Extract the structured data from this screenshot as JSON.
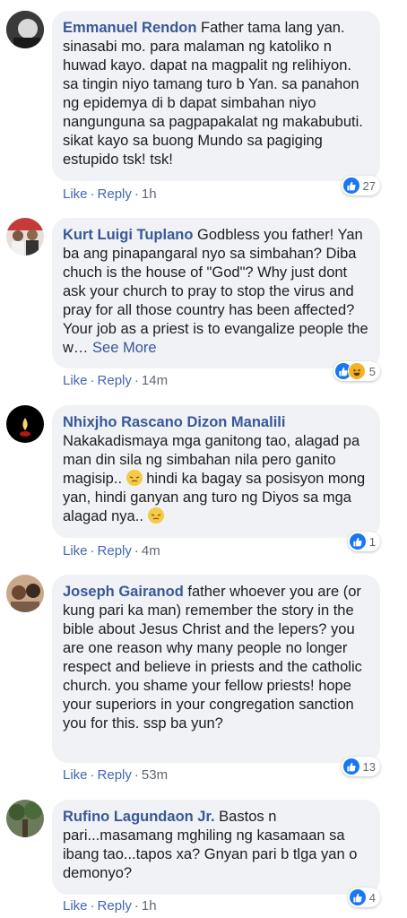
{
  "actions": {
    "like": "Like",
    "reply": "Reply",
    "sep": "·"
  },
  "comments": [
    {
      "author": "Emmanuel Rendon",
      "text": "Father tama lang yan. sinasabi mo. para malaman ng katoliko n huwad kayo. dapat na magpalit ng relihiyon. sa tingin niyo tamang turo b Yan. sa panahon ng epidemya di b dapat simbahan niyo nangunguna sa pagpapakalat ng makabubuti. sikat kayo sa buong Mundo sa pagiging estupido tsk! tsk!",
      "time": "1h",
      "reaction_count": "27",
      "reactions": [
        "like-icon"
      ]
    },
    {
      "author": "Kurt Luigi Tuplano",
      "text": "Godbless you father! Yan ba ang pinapangaral nyo sa simbahan? Diba chuch is the house of \"God\"? Why just dont ask your church to pray to stop the virus and pray for all those country has been affected? Your job as a priest is to evangalize people the w…",
      "see_more": "See More",
      "time": "14m",
      "reaction_count": "5",
      "reactions": [
        "like-icon",
        "haha-icon"
      ]
    },
    {
      "author": "Nhixjho Rascano Dizon Manalili",
      "text_a": "Nakakadismaya mga ganitong tao, alagad pa man din sila ng simbahan nila pero ganito magisip..",
      "text_b": "hindi ka bagay sa posisyon mong yan, hindi ganyan ang turo ng Diyos sa mga alagad nya..",
      "emoji": "pensive-face-emoji",
      "time": "4m",
      "reaction_count": "1",
      "reactions": [
        "like-icon"
      ]
    },
    {
      "author": "Joseph Gairanod",
      "text": "father whoever you are (or kung pari ka man) remember the story in the bible about Jesus Christ and the lepers? you are one reason why many people no longer respect and believe in priests and the catholic church. you shame your fellow priests! hope your superiors in your congregation sanction you for this. ssp ba yun?",
      "time": "53m",
      "reaction_count": "13",
      "reactions": [
        "like-icon"
      ]
    },
    {
      "author": "Rufino Lagundaon Jr.",
      "text": "Bastos n pari...masamang mghiling ng kasamaan sa ibang tao...tapos xa? Gnyan pari b tlga yan o demonyo?",
      "time": "1h",
      "reaction_count": "4",
      "reactions": [
        "like-icon"
      ]
    }
  ]
}
